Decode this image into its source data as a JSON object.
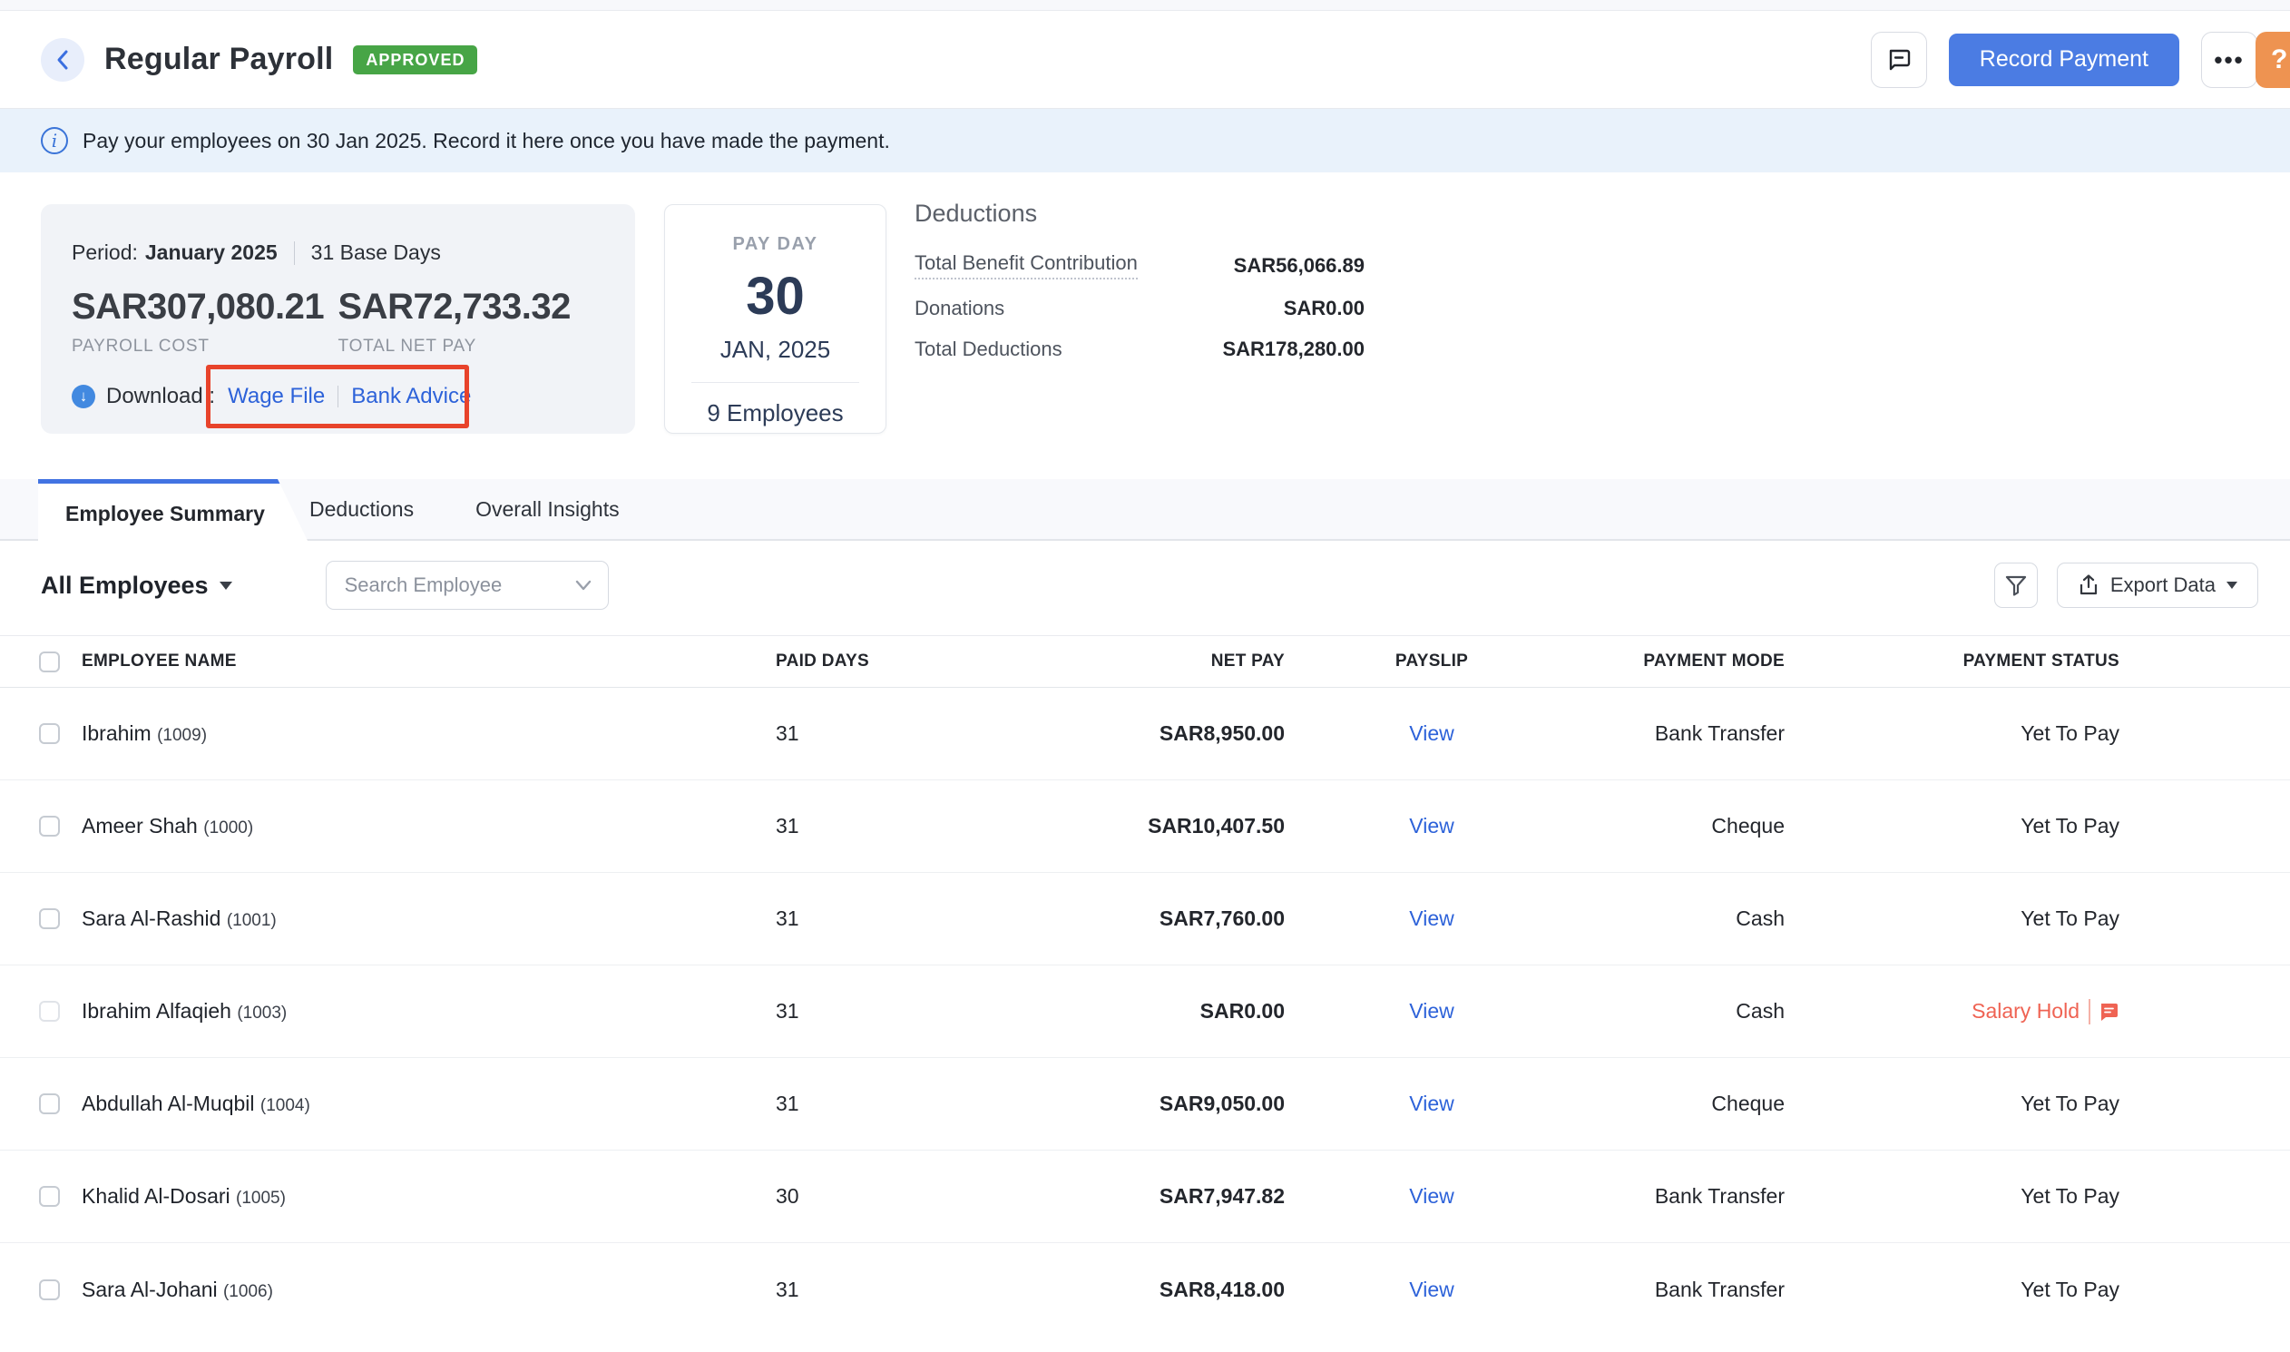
{
  "header": {
    "title": "Regular Payroll",
    "status_badge": "APPROVED",
    "record_payment_label": "Record Payment",
    "more_label": "•••",
    "help_label": "?"
  },
  "banner": {
    "text": "Pay your employees on 30 Jan 2025. Record it here once you have made the payment."
  },
  "summary": {
    "period_label": "Period:",
    "period_value": "January 2025",
    "base_days": "31 Base Days",
    "payroll_cost": "SAR307,080.21",
    "payroll_cost_label": "PAYROLL COST",
    "total_net_pay": "SAR72,733.32",
    "total_net_pay_label": "TOTAL NET PAY",
    "download_label": "Download :",
    "wage_file_label": "Wage File",
    "bank_advice_label": "Bank Advice"
  },
  "payday": {
    "label": "PAY DAY",
    "day": "30",
    "month_year": "JAN, 2025",
    "employees": "9 Employees"
  },
  "deductions": {
    "title": "Deductions",
    "rows": [
      {
        "label": "Total Benefit Contribution",
        "value": "SAR56,066.89",
        "has_tooltip": true
      },
      {
        "label": "Donations",
        "value": "SAR0.00",
        "has_tooltip": false
      },
      {
        "label": "Total Deductions",
        "value": "SAR178,280.00",
        "has_tooltip": false
      }
    ]
  },
  "tabs": [
    {
      "label": "Employee Summary",
      "active": true
    },
    {
      "label": "Deductions",
      "active": false
    },
    {
      "label": "Overall Insights",
      "active": false
    }
  ],
  "toolbar": {
    "employee_filter": "All Employees",
    "search_placeholder": "Search Employee",
    "export_label": "Export Data"
  },
  "table": {
    "columns": [
      "EMPLOYEE NAME",
      "PAID DAYS",
      "NET PAY",
      "PAYSLIP",
      "PAYMENT MODE",
      "PAYMENT STATUS"
    ],
    "payslip_link_label": "View",
    "rows": [
      {
        "name": "Ibrahim",
        "id": "(1009)",
        "paid_days": "31",
        "net_pay": "SAR8,950.00",
        "payment_mode": "Bank Transfer",
        "payment_status": "Yet To Pay",
        "status_type": "normal"
      },
      {
        "name": "Ameer Shah",
        "id": "(1000)",
        "paid_days": "31",
        "net_pay": "SAR10,407.50",
        "payment_mode": "Cheque",
        "payment_status": "Yet To Pay",
        "status_type": "normal"
      },
      {
        "name": "Sara Al-Rashid",
        "id": "(1001)",
        "paid_days": "31",
        "net_pay": "SAR7,760.00",
        "payment_mode": "Cash",
        "payment_status": "Yet To Pay",
        "status_type": "normal"
      },
      {
        "name": "Ibrahim Alfaqieh",
        "id": "(1003)",
        "paid_days": "31",
        "net_pay": "SAR0.00",
        "payment_mode": "Cash",
        "payment_status": "Salary Hold",
        "status_type": "hold"
      },
      {
        "name": "Abdullah Al-Muqbil",
        "id": "(1004)",
        "paid_days": "31",
        "net_pay": "SAR9,050.00",
        "payment_mode": "Cheque",
        "payment_status": "Yet To Pay",
        "status_type": "normal"
      },
      {
        "name": "Khalid Al-Dosari",
        "id": "(1005)",
        "paid_days": "30",
        "net_pay": "SAR7,947.82",
        "payment_mode": "Bank Transfer",
        "payment_status": "Yet To Pay",
        "status_type": "normal"
      },
      {
        "name": "Sara Al-Johani",
        "id": "(1006)",
        "paid_days": "31",
        "net_pay": "SAR8,418.00",
        "payment_mode": "Bank Transfer",
        "payment_status": "Yet To Pay",
        "status_type": "normal"
      }
    ]
  },
  "colors": {
    "accent_blue": "#4b7ce3",
    "link_blue": "#2d62d9",
    "badge_green": "#47a546",
    "salary_hold_red": "#ef6353",
    "annotation_red": "#e8432b",
    "help_orange": "#ee9351",
    "banner_bg": "#e9f2fb",
    "navy": "#2c3b57"
  }
}
